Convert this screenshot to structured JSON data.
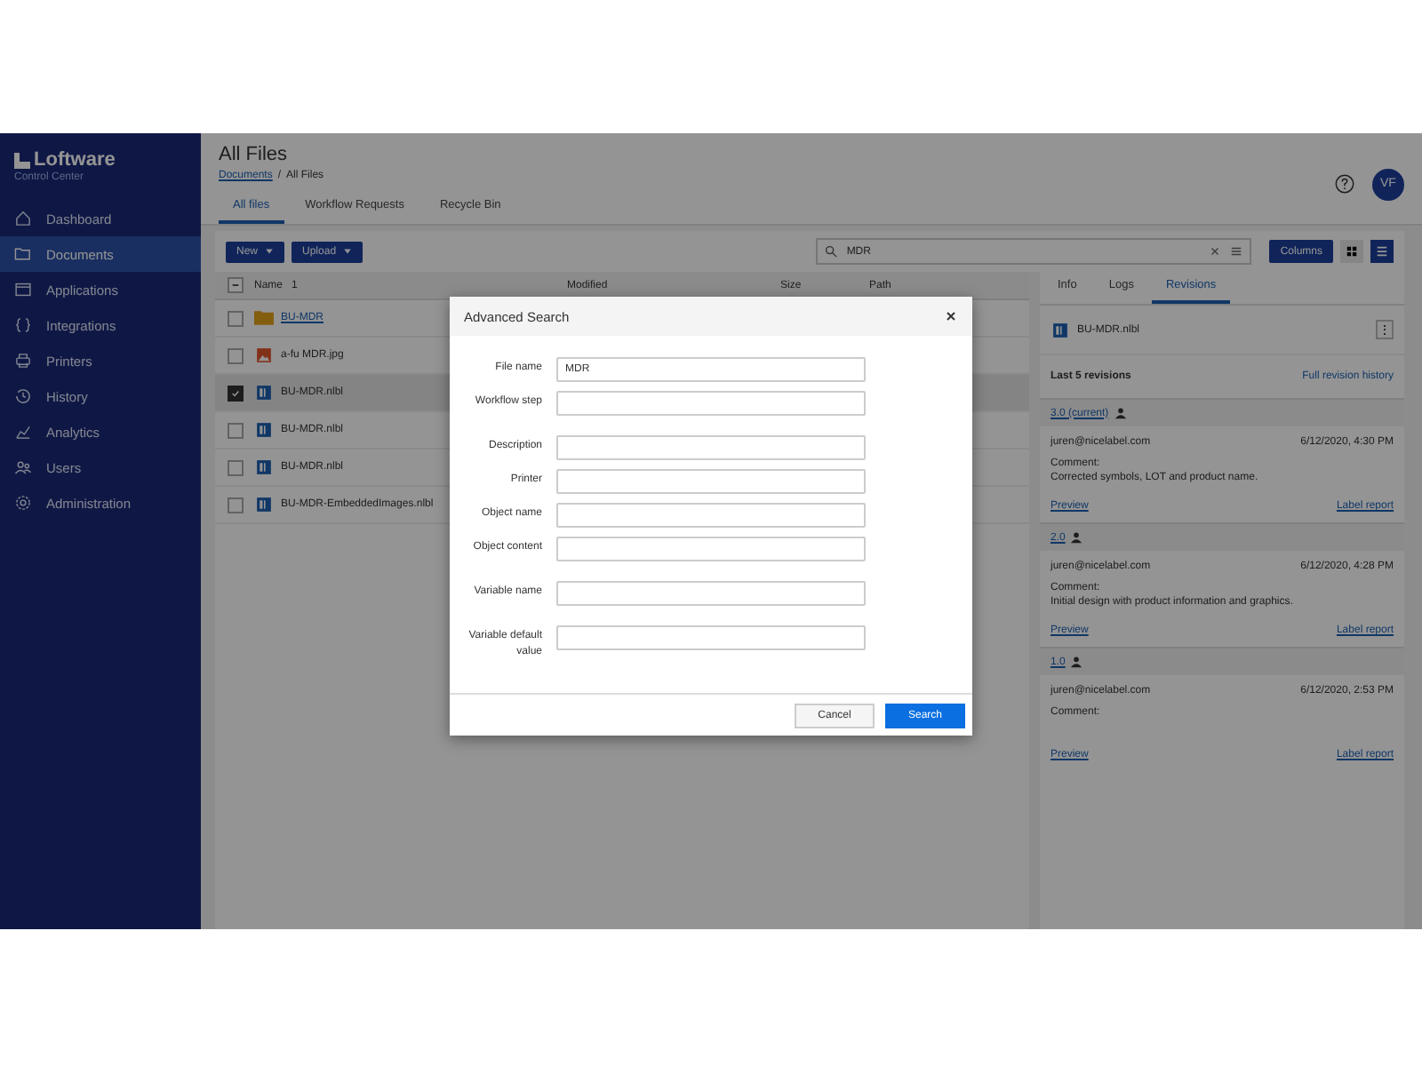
{
  "logo": {
    "name": "Loftware",
    "subtitle": "Control Center"
  },
  "sidebar": {
    "items": [
      {
        "label": "Dashboard",
        "selected": false
      },
      {
        "label": "Documents",
        "selected": true
      },
      {
        "label": "Applications",
        "selected": false
      },
      {
        "label": "Integrations",
        "selected": false
      },
      {
        "label": "Printers",
        "selected": false
      },
      {
        "label": "History",
        "selected": false
      },
      {
        "label": "Analytics",
        "selected": false
      },
      {
        "label": "Users",
        "selected": false
      },
      {
        "label": "Administration",
        "selected": false
      }
    ]
  },
  "header": {
    "title": "All Files",
    "breadcrumb": [
      "Documents",
      "All Files"
    ],
    "breadcrumb_separator": "/",
    "avatar": "VF"
  },
  "tabs": [
    {
      "label": "All files",
      "selected": true
    },
    {
      "label": "Workflow Requests",
      "selected": false
    },
    {
      "label": "Recycle Bin",
      "selected": false
    }
  ],
  "toolbar": {
    "buttons": [
      "New",
      "Upload"
    ],
    "search": {
      "value": "MDR"
    },
    "columns_button": "Columns",
    "views": [
      {
        "selected": false
      },
      {
        "selected": true
      }
    ]
  },
  "table": {
    "columns": [
      "Name",
      "Modified",
      "Size",
      "Path"
    ],
    "sort_indicator": "1",
    "select_all": {
      "indeterminate": true
    },
    "rows": [
      {
        "name": "BU-MDR",
        "kind": "folder",
        "checked": false,
        "selected": false
      },
      {
        "name": "a-fu MDR.jpg",
        "kind": "image",
        "checked": false,
        "selected": false
      },
      {
        "name": "BU-MDR.nlbl",
        "kind": "label",
        "checked": true,
        "selected": true
      },
      {
        "name": "BU-MDR.nlbl",
        "kind": "label",
        "checked": false,
        "selected": false
      },
      {
        "name": "BU-MDR.nlbl",
        "kind": "label",
        "checked": false,
        "selected": false
      },
      {
        "name": "BU-MDR-EmbeddedImages.nlbl",
        "kind": "label",
        "checked": false,
        "selected": false
      }
    ]
  },
  "details": {
    "tabs": [
      {
        "label": "Info",
        "selected": false
      },
      {
        "label": "Logs",
        "selected": false
      },
      {
        "label": "Revisions",
        "selected": true
      }
    ],
    "file": "BU-MDR.nlbl",
    "more": "⋮",
    "heading": "Last 5 revisions",
    "history_link": "Full revision history",
    "revisions": [
      {
        "version": "3.0 (current)",
        "user": "juren@nicelabel.com",
        "date": "6/12/2020, 4:30 PM",
        "comment_label": "Comment:",
        "comment": "Corrected symbols, LOT and product name.",
        "preview": "Preview",
        "report": "Label report"
      },
      {
        "version": "2.0",
        "user": "juren@nicelabel.com",
        "date": "6/12/2020, 4:28 PM",
        "comment_label": "Comment:",
        "comment": "Initial design with product information and graphics.",
        "preview": "Preview",
        "report": "Label report"
      },
      {
        "version": "1.0",
        "user": "juren@nicelabel.com",
        "date": "6/12/2020, 2:53 PM",
        "comment_label": "Comment:",
        "preview": "Preview",
        "report": "Label report"
      }
    ]
  },
  "dialog": {
    "title": "Advanced Search",
    "fields": [
      {
        "label": "File name",
        "value": "MDR"
      },
      {
        "label": "Workflow step"
      },
      {
        "label": "Description"
      },
      {
        "label": "Printer"
      },
      {
        "label": "Object name"
      },
      {
        "label": "Object content"
      },
      {
        "label": "Variable name"
      },
      {
        "label": "Variable default value"
      }
    ],
    "buttons": [
      {
        "label": "Cancel",
        "kind": "secondary"
      },
      {
        "label": "Search",
        "kind": "primary"
      }
    ]
  }
}
